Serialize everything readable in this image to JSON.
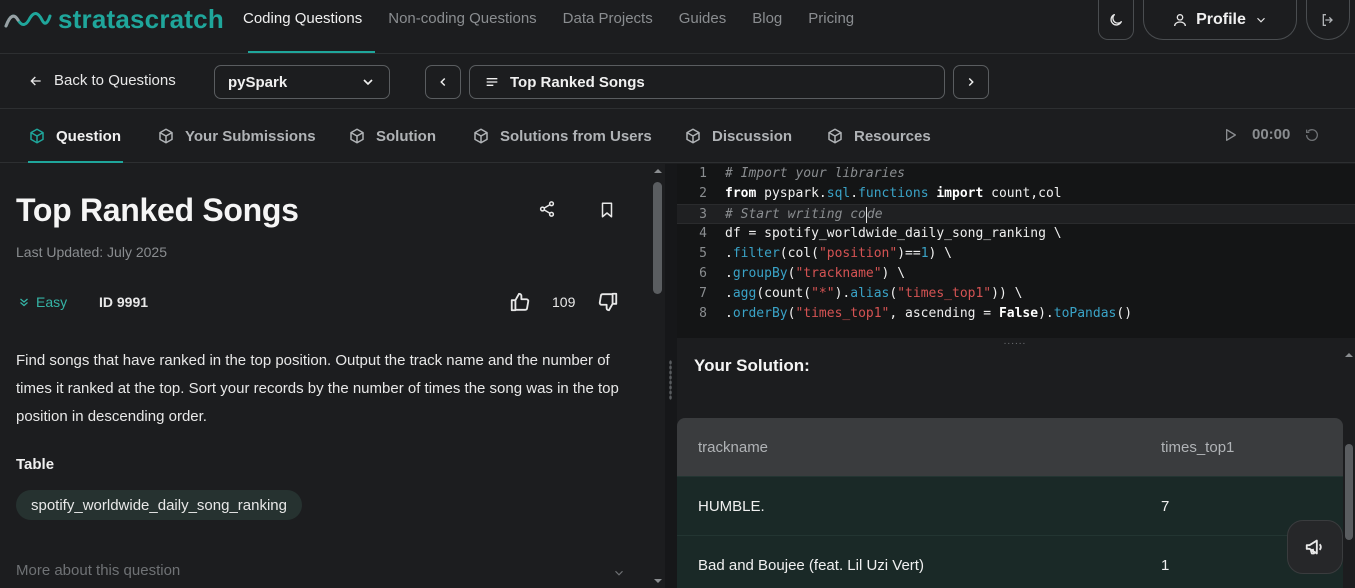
{
  "brand": {
    "name": "stratascratch"
  },
  "nav": {
    "links": [
      "Coding Questions",
      "Non-coding Questions",
      "Data Projects",
      "Guides",
      "Blog",
      "Pricing"
    ],
    "active_index": 0,
    "profile_label": "Profile"
  },
  "toolbar": {
    "back_label": "Back to Questions",
    "language": "pySpark",
    "question_title": "Top Ranked Songs"
  },
  "tabs": {
    "items": [
      "Question",
      "Your Submissions",
      "Solution",
      "Solutions from Users",
      "Discussion",
      "Resources"
    ],
    "active_index": 0,
    "timer": "00:00"
  },
  "question": {
    "title": "Top Ranked Songs",
    "last_updated": "Last Updated: July 2025",
    "difficulty": "Easy",
    "id_label": "ID 9991",
    "likes": "109",
    "description": "Find songs that have ranked in the top position. Output the track name and the number of times it ranked at the top. Sort your records by the number of times the song was in the top position in descending order.",
    "table_label": "Table",
    "table_name": "spotify_worldwide_daily_song_ranking",
    "more_label": "More about this question"
  },
  "editor": {
    "line_numbers": [
      "1",
      "2",
      "3",
      "4",
      "5",
      "6",
      "7",
      "8"
    ],
    "current_line": 3
  },
  "results": {
    "title": "Your Solution:",
    "columns": [
      "trackname",
      "times_top1"
    ],
    "rows": [
      [
        "HUMBLE.",
        "7"
      ],
      [
        "Bad and Boujee (feat. Lil Uzi Vert)",
        "1"
      ]
    ]
  },
  "colors": {
    "accent": "#1fa69b",
    "background": "#1c1d1f",
    "easy": "#35b4a6"
  }
}
